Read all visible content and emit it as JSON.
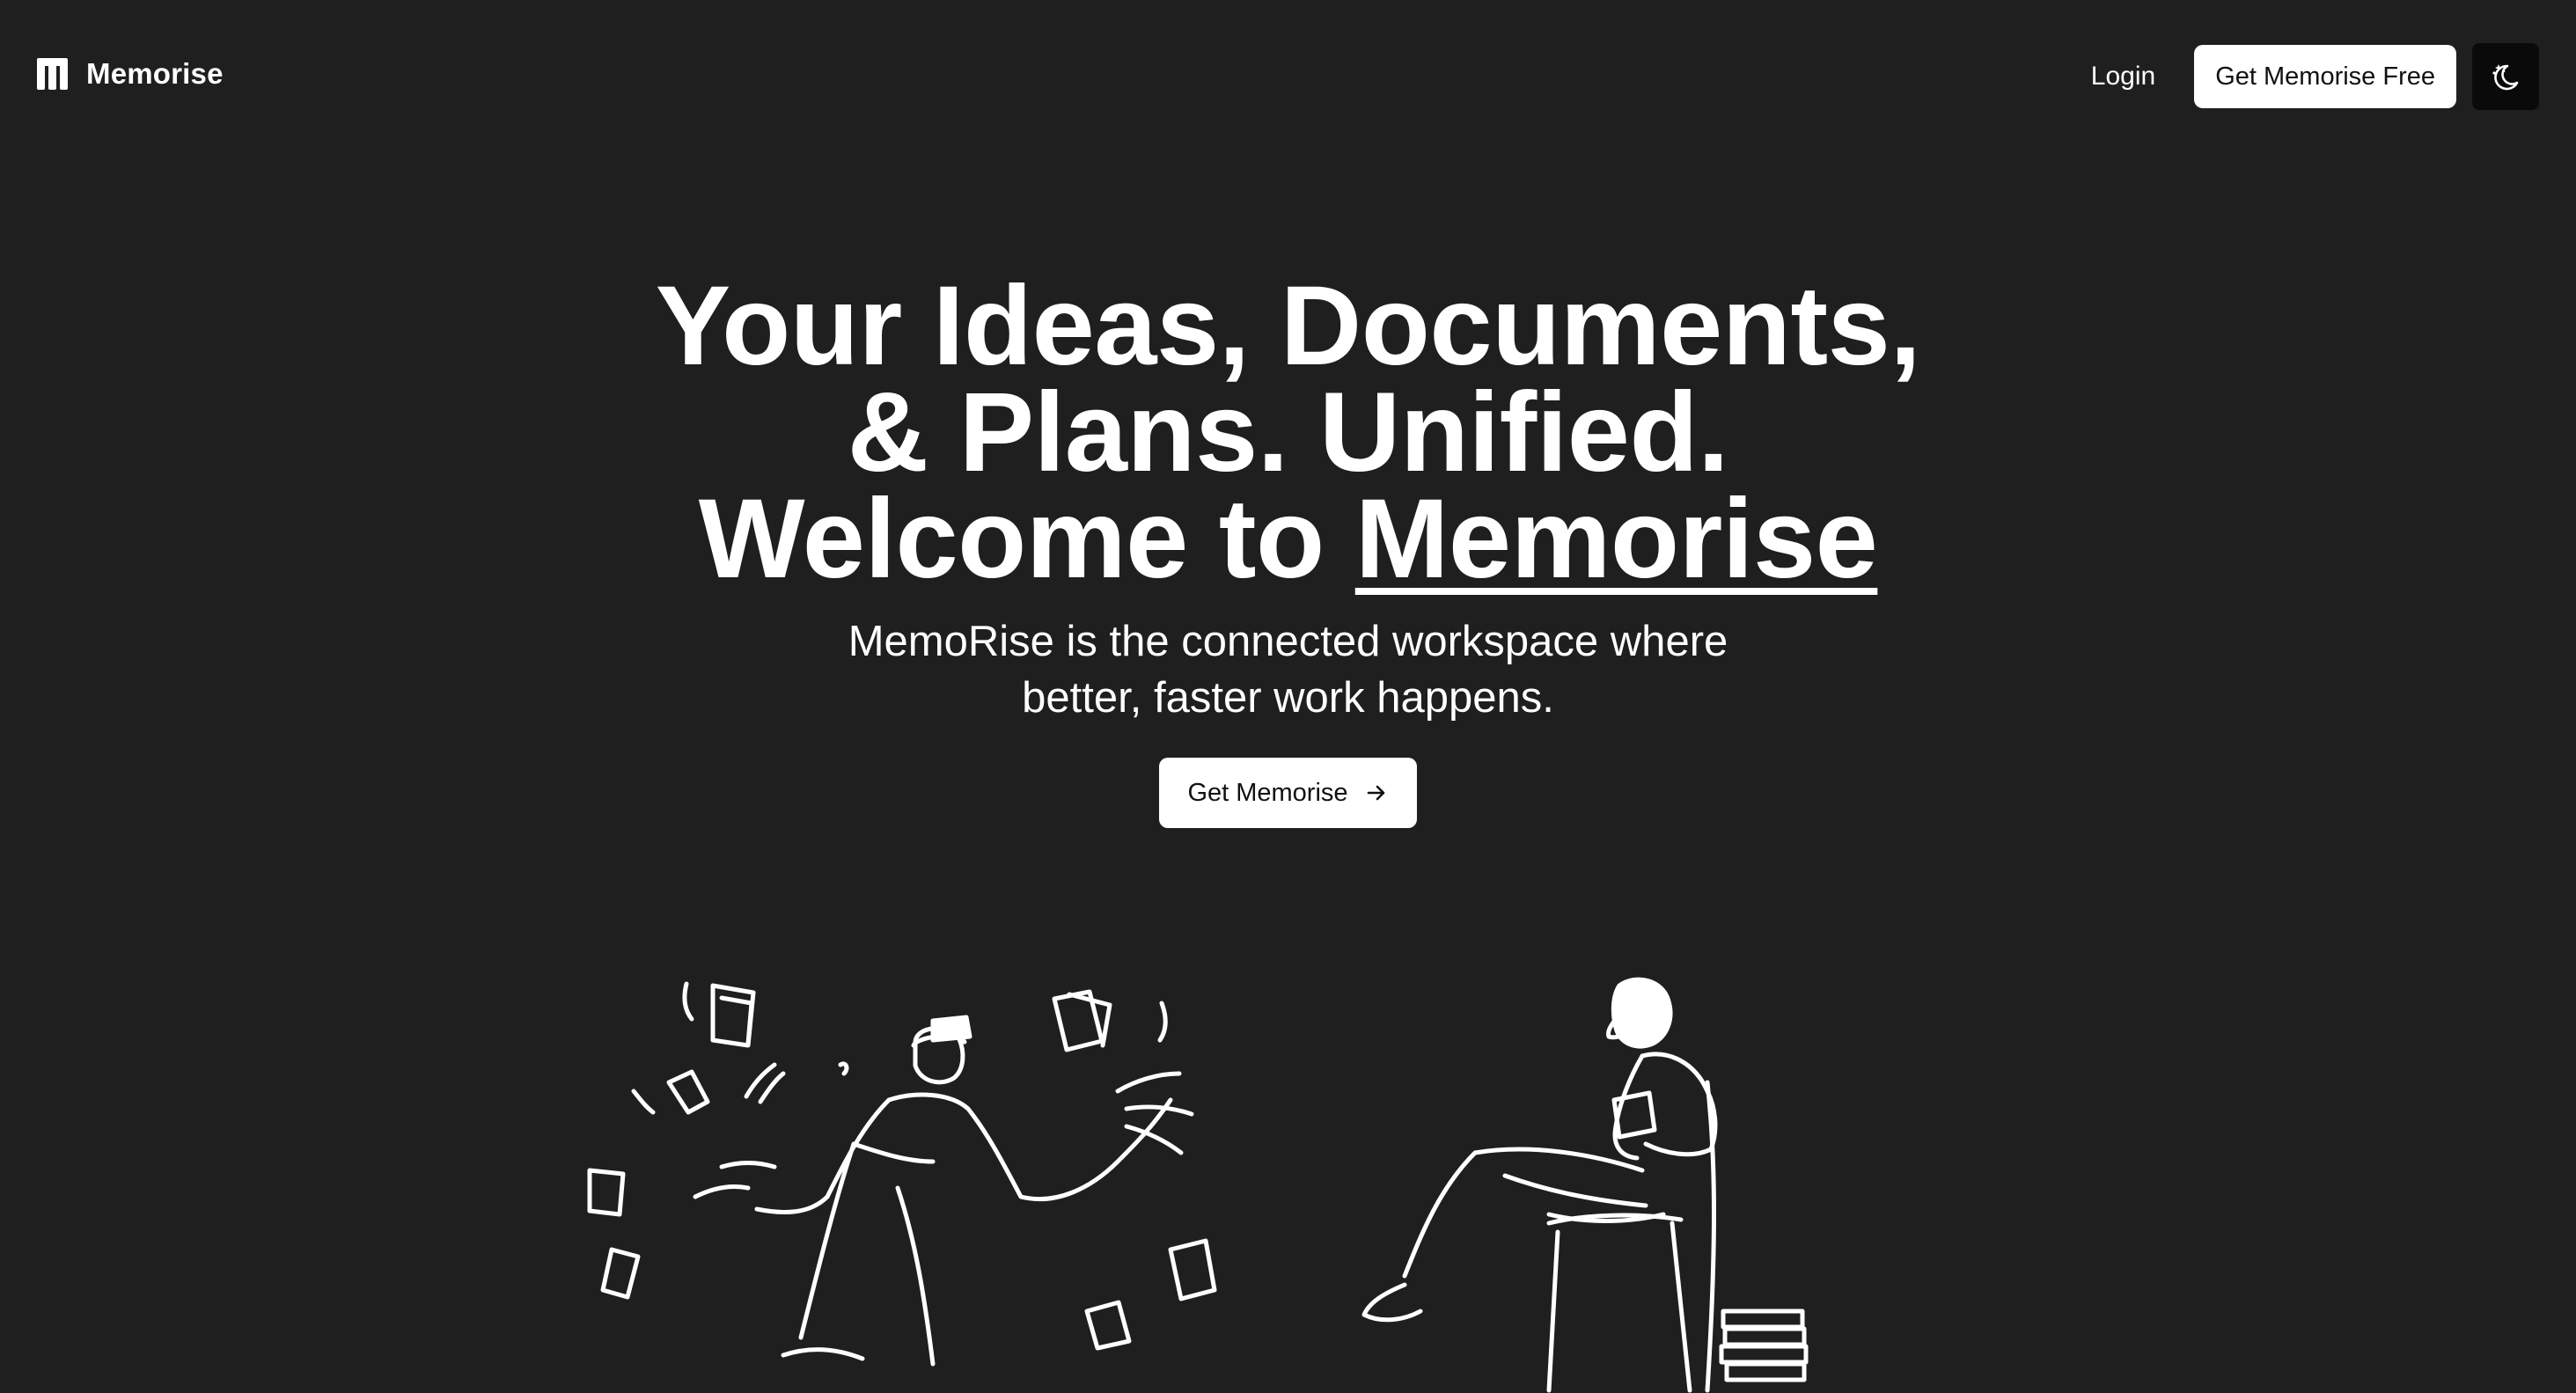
{
  "header": {
    "brand_name": "Memorise",
    "login_label": "Login",
    "cta_label": "Get Memorise Free",
    "theme_toggle_icon": "moon-stars-icon"
  },
  "hero": {
    "headline_part1": "Your Ideas, Documents, & Plans. Unified. Welcome to ",
    "headline_brand": "Memorise",
    "subhead": "MemoRise is the connected workspace where better, faster work happens.",
    "cta_label": "Get Memorise",
    "cta_icon": "arrow-right-icon"
  },
  "illustration": {
    "left_figure": "man-juggling-papers",
    "right_figure": "woman-reading-in-chair",
    "stroke_color": "#ffffff"
  },
  "colors": {
    "background": "#1f1f1f",
    "text": "#ffffff",
    "button_bg": "#ffffff",
    "button_text": "#111111",
    "toggle_bg": "#0a0a0a"
  }
}
